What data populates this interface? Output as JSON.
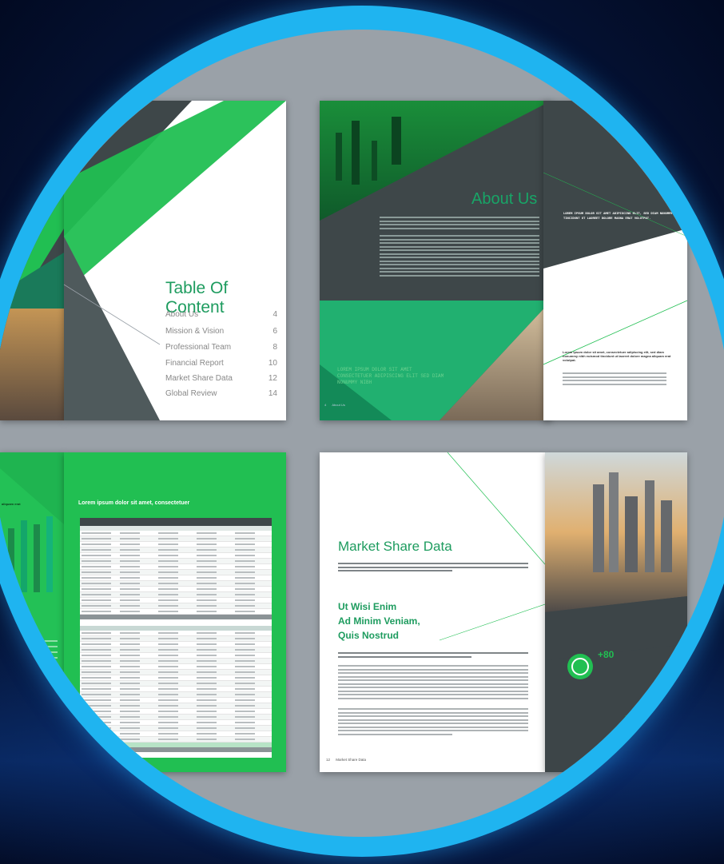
{
  "toc": {
    "title": "Table Of Content",
    "items": [
      {
        "label": "About Us",
        "page": "4"
      },
      {
        "label": "Mission & Vision",
        "page": "6"
      },
      {
        "label": "Professional Team",
        "page": "8"
      },
      {
        "label": "Financial Report",
        "page": "10"
      },
      {
        "label": "Market Share Data",
        "page": "12"
      },
      {
        "label": "Global Review",
        "page": "14"
      }
    ]
  },
  "about": {
    "title": "About Us",
    "quote": "LOREM IPSUM DOLOR SIT AMET CONSECTETUER ADIPISCING ELIT SED DIAM NONUMMY NIBH",
    "footer_page": "4",
    "footer_label": "About Us",
    "side_quote": "LOREM IPSUM DOLOR SIT AMET ADIPISCING ELIT, SED DIAM NONUMMY TINCIDUNT UT LAOREET DOLORE MAGNA ERAT VOLUTPAT.",
    "side_heading": "Lorem ipsum dolor sit amet, consectetuer adipiscing elit, sed diam nonummy nibh euismod tincidunt ut laoreet dolore magna aliquam erat volutpat."
  },
  "financial": {
    "title": "Lorem ipsum dolor sit amet, consectetuer",
    "chart_caption": "aliquam erat"
  },
  "market": {
    "title": "Market Share Data",
    "subtitle_lines": [
      "Ut Wisi Enim",
      "Ad Minim Veniam,",
      "Quis Nostrud"
    ],
    "stat": "+80",
    "footer_page": "12",
    "footer_label": "Market Share Data"
  },
  "colors": {
    "ring": "#1fb4f0",
    "brand_green": "#1e9c5f",
    "bright_green": "#21bf52",
    "slate": "#3e4749",
    "background": "#071a45"
  }
}
